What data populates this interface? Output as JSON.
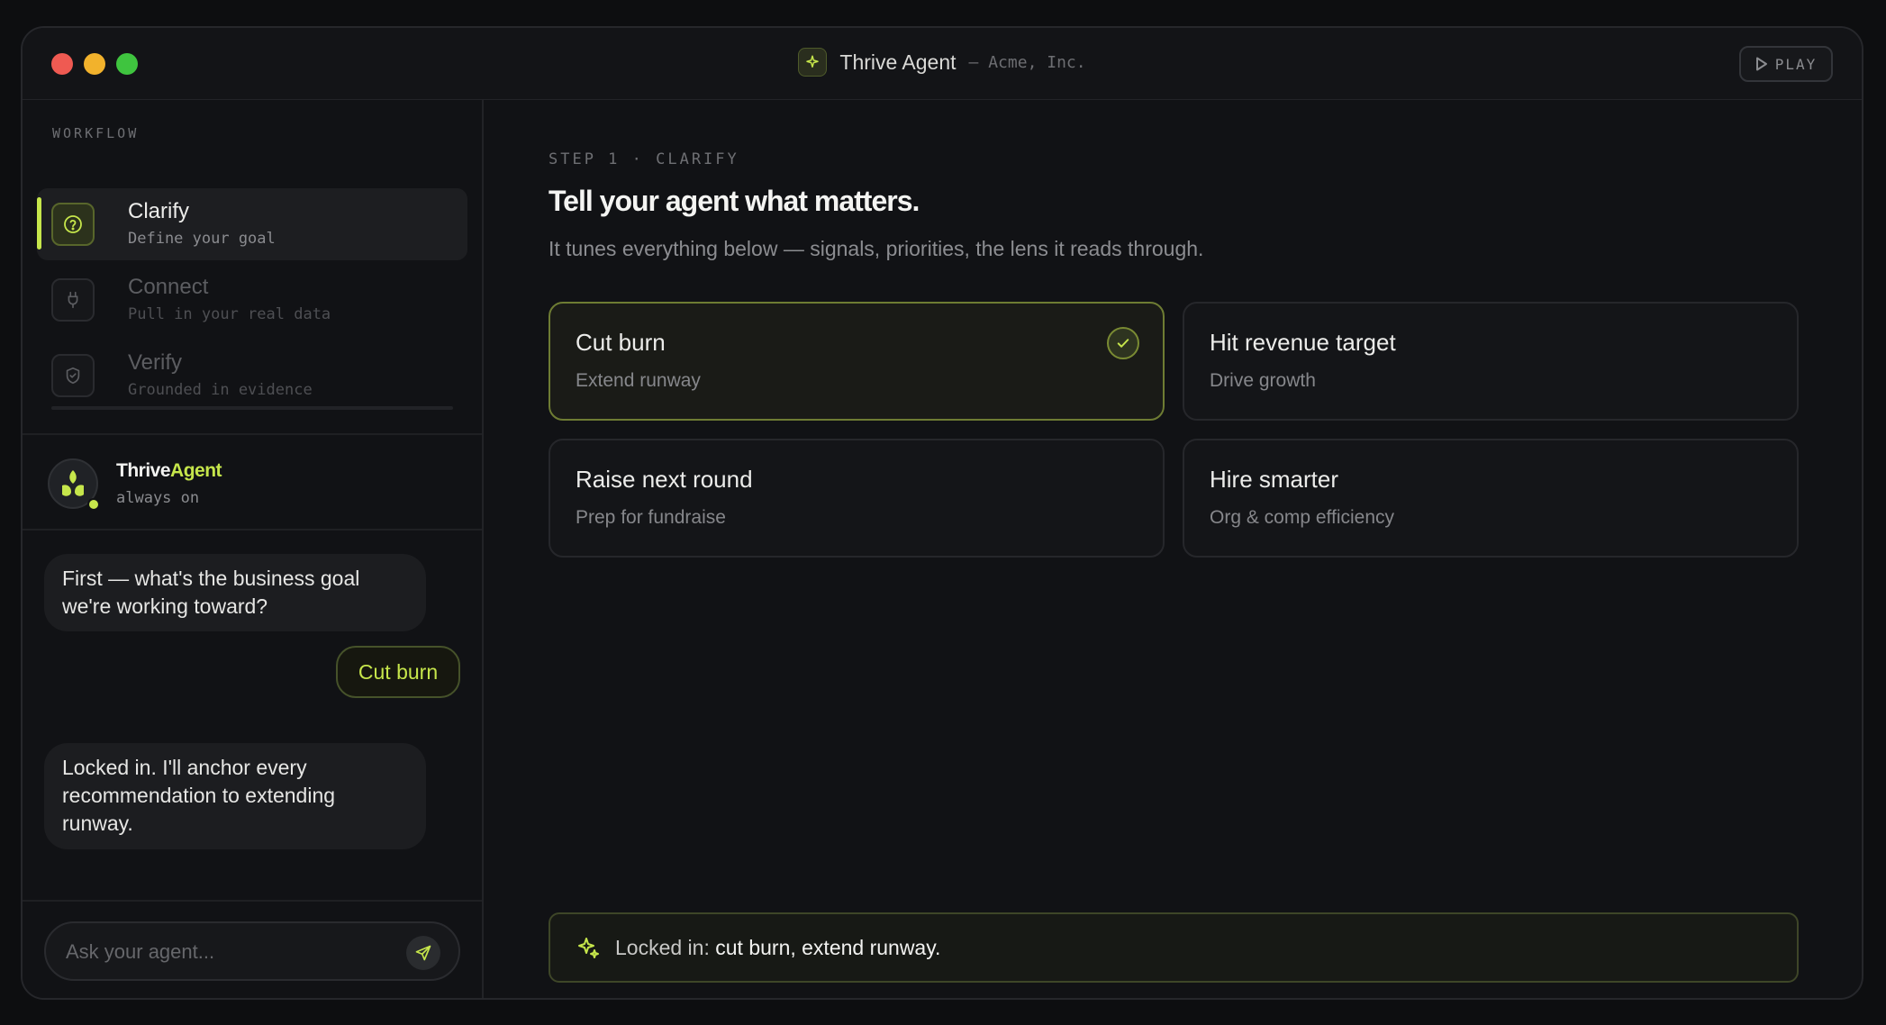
{
  "window": {
    "app_title": "Thrive Agent",
    "org": "– Acme, Inc.",
    "play_label": "PLAY"
  },
  "sidebar": {
    "section_label": "WORKFLOW",
    "steps": [
      {
        "title": "Clarify",
        "subtitle": "Define your goal",
        "icon": "question-icon",
        "active": true
      },
      {
        "title": "Connect",
        "subtitle": "Pull in your real data",
        "icon": "plug-icon",
        "active": false
      },
      {
        "title": "Verify",
        "subtitle": "Grounded in evidence",
        "icon": "shield-check-icon",
        "active": false
      }
    ]
  },
  "agent": {
    "name_part1": "Thrive",
    "name_part2": "Agent",
    "status": "always on"
  },
  "chat": {
    "messages": [
      {
        "from": "agent",
        "text": "First — what's the business goal we're working toward?"
      },
      {
        "from": "user",
        "text": "Cut burn"
      },
      {
        "from": "agent",
        "text": "Locked in. I'll anchor every recommendation to extending runway."
      }
    ],
    "composer_placeholder": "Ask your agent..."
  },
  "main": {
    "step_label": "STEP 1 · CLARIFY",
    "headline": "Tell your agent what matters.",
    "subline": "It tunes everything below — signals, priorities, the lens it reads through.",
    "goals": [
      {
        "title": "Cut burn",
        "subtitle": "Extend runway",
        "selected": true
      },
      {
        "title": "Hit revenue target",
        "subtitle": "Drive growth",
        "selected": false
      },
      {
        "title": "Raise next round",
        "subtitle": "Prep for fundraise",
        "selected": false
      },
      {
        "title": "Hire smarter",
        "subtitle": "Org & comp efficiency",
        "selected": false
      }
    ],
    "locked_prefix": "Locked in:",
    "locked_value": "cut burn, extend runway."
  },
  "colors": {
    "accent": "#c6e64b",
    "background": "#111215"
  }
}
